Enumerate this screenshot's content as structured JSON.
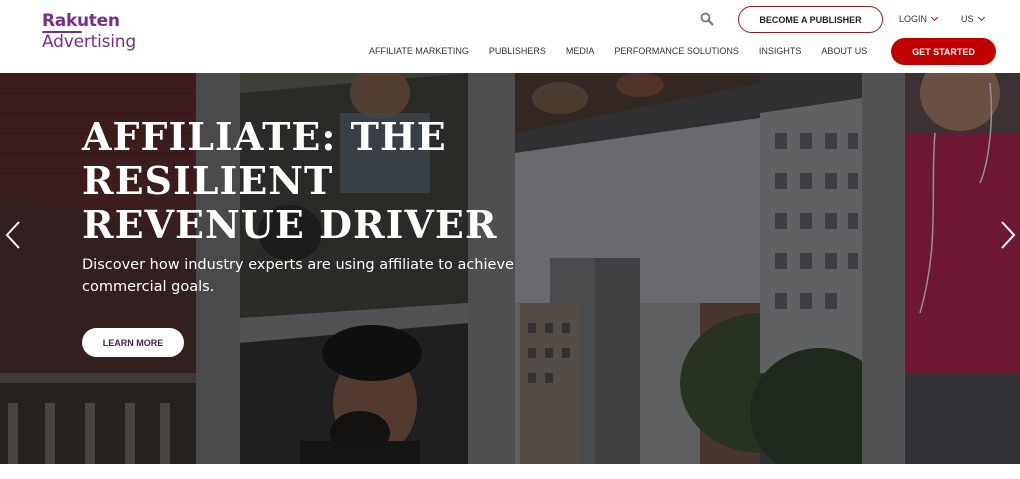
{
  "brand": {
    "logo_line1": "Rakuten",
    "logo_line2": "Advertising",
    "logo_color": "#7b2d8e"
  },
  "header": {
    "search_icon": "search-icon",
    "become_publisher_label": "BECOME A PUBLISHER",
    "login_label": "LOGIN",
    "region_label": "US",
    "get_started_label": "GET STARTED",
    "accent_color": "#bf0000"
  },
  "nav": {
    "items": [
      {
        "label": "AFFILIATE MARKETING"
      },
      {
        "label": "PUBLISHERS"
      },
      {
        "label": "MEDIA"
      },
      {
        "label": "PERFORMANCE SOLUTIONS"
      },
      {
        "label": "INSIGHTS"
      },
      {
        "label": "ABOUT US"
      }
    ]
  },
  "hero": {
    "title": "AFFILIATE: THE RESILIENT REVENUE DRIVER",
    "subtitle": "Discover how industry experts are using affiliate to achieve commercial goals.",
    "cta_label": "LEARN MORE",
    "prev_icon": "chevron-left-icon",
    "next_icon": "chevron-right-icon"
  }
}
